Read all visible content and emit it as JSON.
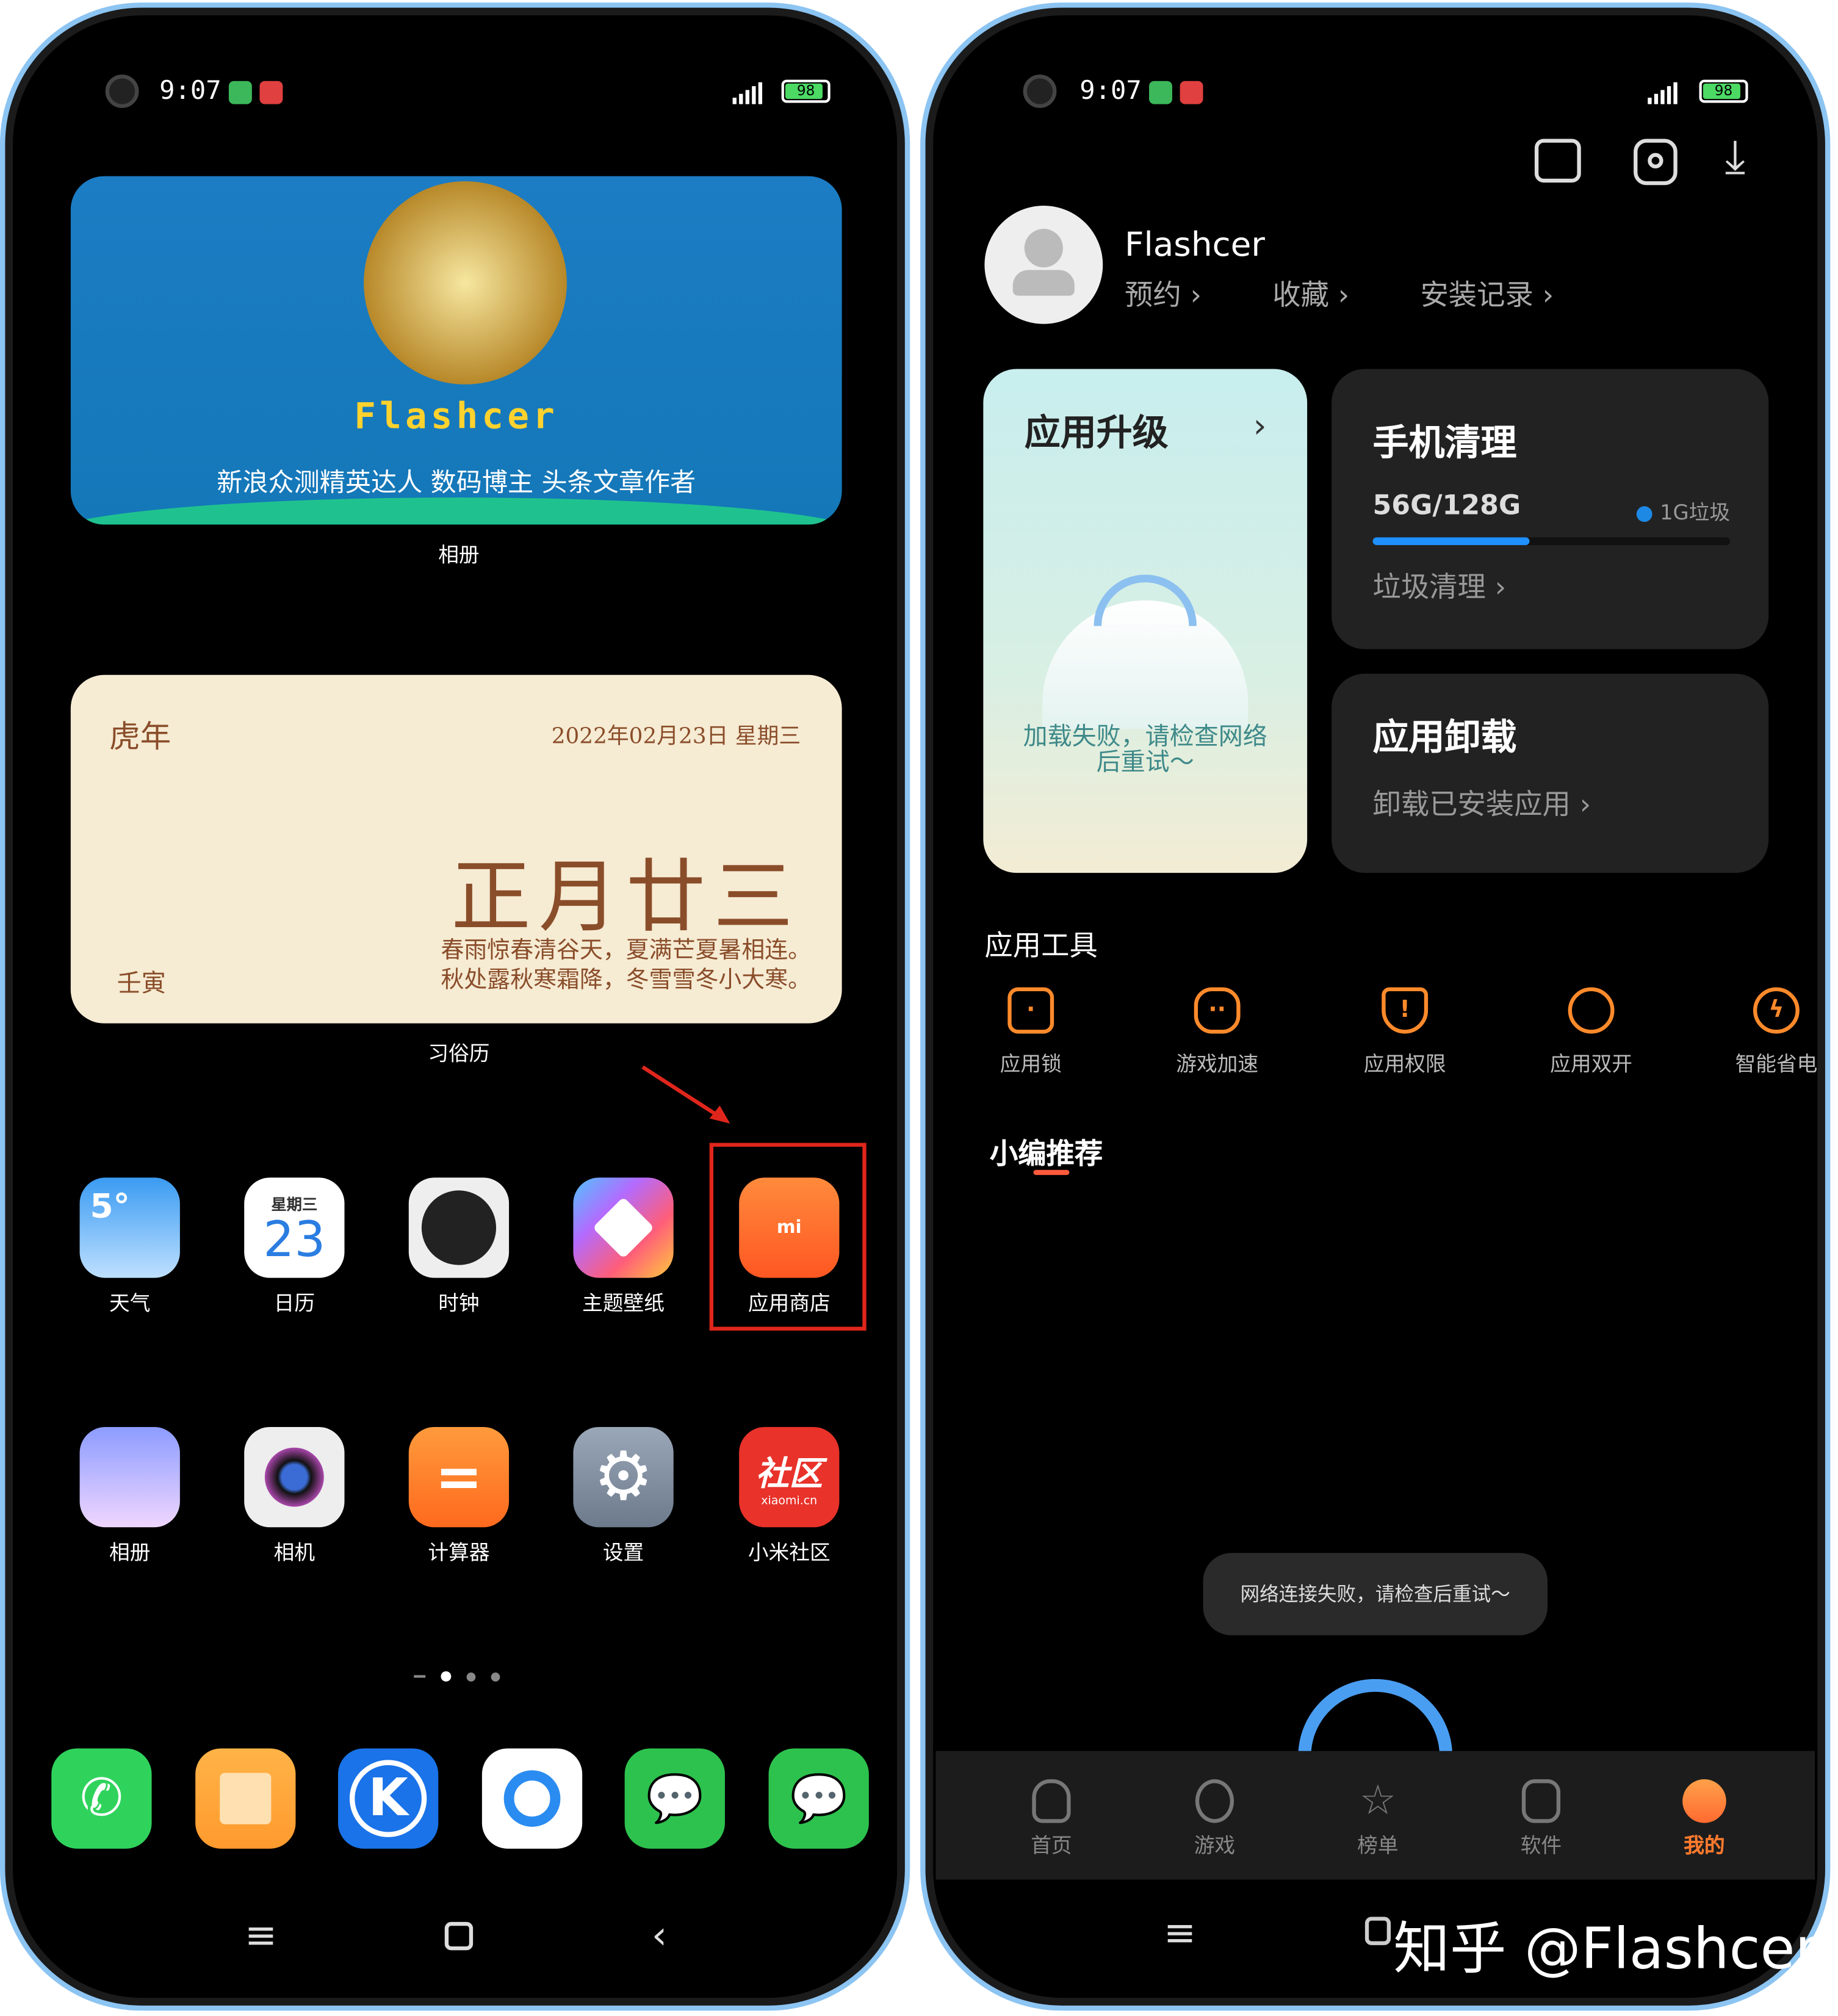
{
  "left_phone": {
    "status": {
      "time": "9:07",
      "battery": "98"
    },
    "photo_widget": {
      "banner_name": "Flashcer",
      "banner_tagline": "新浪众测精英达人 数码博主 头条文章作者",
      "label": "相册"
    },
    "calendar_widget": {
      "year_label": "虎年",
      "date": "2022年02月23日 星期三",
      "lunar_date": "正月廿三",
      "rhyme_line1": "春雨惊春清谷天，夏满芒夏暑相连。",
      "rhyme_line2": "秋处露秋寒霜降，冬雪雪冬小大寒。",
      "ganzhi": "壬寅",
      "label": "习俗历"
    },
    "apps_row1": [
      {
        "label": "天气",
        "glyph": "5°"
      },
      {
        "label": "日历",
        "glyph": "23",
        "sub": "星期三"
      },
      {
        "label": "时钟"
      },
      {
        "label": "主题壁纸"
      },
      {
        "label": "应用商店",
        "glyph": "mi"
      }
    ],
    "apps_row2": [
      {
        "label": "相册"
      },
      {
        "label": "相机"
      },
      {
        "label": "计算器",
        "glyph": "="
      },
      {
        "label": "设置",
        "glyph": "⚙"
      },
      {
        "label": "小米社区",
        "glyph": "社区",
        "sub": "xiaomi.cn"
      }
    ],
    "dock": [
      "phone-icon",
      "notes-icon",
      "kugou-icon",
      "browser-icon",
      "wechat-clone-icon",
      "wechat-icon"
    ],
    "highlight_color": "#e0261c"
  },
  "right_phone": {
    "status": {
      "time": "9:07",
      "battery": "98"
    },
    "top_icons": [
      "message-icon",
      "settings-icon",
      "download-icon"
    ],
    "profile": {
      "name": "Flashcer",
      "links": [
        "预约",
        "收藏",
        "安装记录"
      ]
    },
    "upgrade_card": {
      "title": "应用升级",
      "error": "加载失败，请检查网络后重试～"
    },
    "clean_card": {
      "title": "手机清理",
      "storage": "56G/128G",
      "junk": "1G垃圾",
      "used_fraction": 0.44,
      "action": "垃圾清理"
    },
    "uninstall_card": {
      "title": "应用卸载",
      "action": "卸载已安装应用"
    },
    "tools": {
      "title": "应用工具",
      "items": [
        "应用锁",
        "游戏加速",
        "应用权限",
        "应用双开",
        "智能省电"
      ]
    },
    "recommend": {
      "title": "小编推荐"
    },
    "toast": "网络连接失败，请检查后重试～",
    "tabs": [
      {
        "label": "首页"
      },
      {
        "label": "游戏"
      },
      {
        "label": "榜单"
      },
      {
        "label": "软件"
      },
      {
        "label": "我的",
        "active": true
      }
    ],
    "accent": "#ff7a2e"
  },
  "watermark": "知乎 @Flashcer"
}
